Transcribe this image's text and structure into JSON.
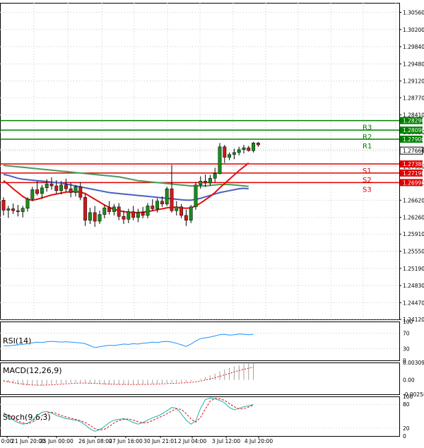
{
  "chart_data": {
    "type": "candlestick",
    "main": {
      "ylim": [
        1.2412,
        1.3076
      ],
      "yticks": [
        "1.30560",
        "1.30200",
        "1.29840",
        "1.29480",
        "1.29120",
        "1.28770",
        "1.28410",
        "1.28050",
        "1.27690",
        "1.27330",
        "1.26980",
        "1.26620",
        "1.26260",
        "1.25910",
        "1.25550",
        "1.25190",
        "1.24830",
        "1.24470",
        "1.24120"
      ],
      "xticks": [
        "0:00",
        "21 Jun 20:00",
        "25 Jun 00:00",
        "26 Jun 08:00",
        "27 Jun 16:00",
        "30 Jun 21:01",
        "2 Jul 04:00",
        "3 Jul 12:00",
        "4 Jul 20:00"
      ],
      "candles": [
        [
          1.2662,
          1.2668,
          1.263,
          1.2641
        ],
        [
          1.2641,
          1.265,
          1.2625,
          1.2644
        ],
        [
          1.2644,
          1.2655,
          1.2633,
          1.264
        ],
        [
          1.264,
          1.2652,
          1.2628,
          1.2638
        ],
        [
          1.2638,
          1.265,
          1.2626,
          1.2645
        ],
        [
          1.2645,
          1.2668,
          1.2638,
          1.2665
        ],
        [
          1.2665,
          1.269,
          1.266,
          1.2684
        ],
        [
          1.2684,
          1.2702,
          1.2672,
          1.2676
        ],
        [
          1.2676,
          1.2694,
          1.2665,
          1.2688
        ],
        [
          1.2688,
          1.2706,
          1.268,
          1.2696
        ],
        [
          1.2696,
          1.271,
          1.2684,
          1.2692
        ],
        [
          1.2692,
          1.2704,
          1.2676,
          1.2682
        ],
        [
          1.2682,
          1.2702,
          1.2674,
          1.2694
        ],
        [
          1.2694,
          1.2707,
          1.268,
          1.2686
        ],
        [
          1.2686,
          1.2699,
          1.2668,
          1.2678
        ],
        [
          1.2678,
          1.2694,
          1.267,
          1.269
        ],
        [
          1.269,
          1.27,
          1.2662,
          1.2668
        ],
        [
          1.2668,
          1.2676,
          1.2608,
          1.262
        ],
        [
          1.262,
          1.2646,
          1.2612,
          1.2636
        ],
        [
          1.2636,
          1.265,
          1.2606,
          1.2618
        ],
        [
          1.2618,
          1.264,
          1.2612,
          1.2632
        ],
        [
          1.2632,
          1.2652,
          1.2624,
          1.2646
        ],
        [
          1.2646,
          1.266,
          1.2632,
          1.2638
        ],
        [
          1.2638,
          1.2654,
          1.263,
          1.2648
        ],
        [
          1.2648,
          1.2656,
          1.262,
          1.2628
        ],
        [
          1.2628,
          1.264,
          1.2612,
          1.2622
        ],
        [
          1.2622,
          1.2644,
          1.2614,
          1.2638
        ],
        [
          1.2638,
          1.265,
          1.262,
          1.2626
        ],
        [
          1.2626,
          1.2644,
          1.2616,
          1.2636
        ],
        [
          1.2636,
          1.2648,
          1.2624,
          1.263
        ],
        [
          1.263,
          1.2656,
          1.2624,
          1.265
        ],
        [
          1.265,
          1.2664,
          1.264,
          1.2644
        ],
        [
          1.2644,
          1.2666,
          1.2636,
          1.266
        ],
        [
          1.266,
          1.267,
          1.2648,
          1.2654
        ],
        [
          1.2654,
          1.269,
          1.265,
          1.2686
        ],
        [
          1.2686,
          1.2736,
          1.2636,
          1.264
        ],
        [
          1.264,
          1.266,
          1.263,
          1.2648
        ],
        [
          1.2648,
          1.2654,
          1.2624,
          1.263
        ],
        [
          1.263,
          1.2642,
          1.2608,
          1.262
        ],
        [
          1.262,
          1.2652,
          1.2614,
          1.2648
        ],
        [
          1.2648,
          1.27,
          1.2642,
          1.2694
        ],
        [
          1.2694,
          1.2712,
          1.2686,
          1.2702
        ],
        [
          1.2702,
          1.2716,
          1.269,
          1.2698
        ],
        [
          1.2698,
          1.2715,
          1.2692,
          1.2708
        ],
        [
          1.2708,
          1.273,
          1.27,
          1.2718
        ],
        [
          1.2718,
          1.2782,
          1.2716,
          1.2774
        ],
        [
          1.2774,
          1.2778,
          1.274,
          1.2752
        ],
        [
          1.2752,
          1.2762,
          1.2746,
          1.2758
        ],
        [
          1.2758,
          1.277,
          1.2748,
          1.2762
        ],
        [
          1.2762,
          1.2774,
          1.2756,
          1.2768
        ],
        [
          1.2768,
          1.2778,
          1.276,
          1.2772
        ],
        [
          1.2772,
          1.2776,
          1.2764,
          1.2766
        ],
        [
          1.2766,
          1.2784,
          1.2762,
          1.2782
        ],
        [
          1.2782,
          1.2784,
          1.2774,
          1.2778
        ]
      ],
      "ma_slow": [
        1.2735,
        1.2734,
        1.2733,
        1.2732,
        1.2731,
        1.273,
        1.2729,
        1.2728,
        1.2727,
        1.2726,
        1.2725,
        1.2724,
        1.2723,
        1.2722,
        1.2721,
        1.272,
        1.2719,
        1.2718,
        1.2717,
        1.2716,
        1.2715,
        1.2714,
        1.2713,
        1.2712,
        1.2711,
        1.2709,
        1.2707,
        1.2705,
        1.2703,
        1.2702,
        1.2701,
        1.27,
        1.2699,
        1.2698,
        1.2697,
        1.2696,
        1.2695,
        1.2694,
        1.2693,
        1.2692,
        1.2692,
        1.2692,
        1.2692,
        1.2693,
        1.2694,
        1.2695,
        1.2695,
        1.2695,
        1.2694,
        1.2693,
        1.2692,
        1.2691
      ],
      "ma_mid": [
        1.2716,
        1.2714,
        1.2711,
        1.2708,
        1.2706,
        1.2705,
        1.2704,
        1.2703,
        1.2702,
        1.2701,
        1.27,
        1.2699,
        1.2698,
        1.2696,
        1.2694,
        1.2692,
        1.269,
        1.2688,
        1.2686,
        1.2684,
        1.2682,
        1.268,
        1.2678,
        1.2677,
        1.2676,
        1.2675,
        1.2674,
        1.2673,
        1.2672,
        1.2671,
        1.267,
        1.2669,
        1.2668,
        1.2667,
        1.2666,
        1.2665,
        1.2664,
        1.2663,
        1.2662,
        1.2662,
        1.2664,
        1.2666,
        1.2669,
        1.2672,
        1.2675,
        1.2678,
        1.268,
        1.2682,
        1.2684,
        1.2686,
        1.2687,
        1.2686
      ],
      "ma_fast": [
        1.2703,
        1.2695,
        1.2686,
        1.2678,
        1.267,
        1.2664,
        1.2662,
        1.2664,
        1.2667,
        1.267,
        1.2673,
        1.2675,
        1.2677,
        1.2679,
        1.268,
        1.268,
        1.2679,
        1.2676,
        1.267,
        1.2664,
        1.2658,
        1.2652,
        1.2647,
        1.2643,
        1.264,
        1.2638,
        1.2637,
        1.2636,
        1.2636,
        1.2637,
        1.2638,
        1.264,
        1.2642,
        1.2644,
        1.2646,
        1.2647,
        1.2647,
        1.2646,
        1.2645,
        1.2646,
        1.265,
        1.2656,
        1.2663,
        1.267,
        1.2678,
        1.2688,
        1.2697,
        1.2706,
        1.2715,
        1.2724,
        1.2732,
        1.274
      ],
      "levels": [
        {
          "name": "R3",
          "value": 1.2829,
          "label": "1.28290"
        },
        {
          "name": "R2",
          "value": 1.2809,
          "label": "1.28090"
        },
        {
          "name": "R1",
          "value": 1.279,
          "label": "1.27900"
        },
        {
          "name": "S1",
          "value": 1.2738,
          "label": "1.27380"
        },
        {
          "name": "S2",
          "value": 1.2719,
          "label": "1.27190"
        },
        {
          "name": "S3",
          "value": 1.2699,
          "label": "1.26990"
        }
      ],
      "current_price": "1.27660",
      "current_value": 1.2766
    },
    "rsi": {
      "label": "RSI(14)",
      "ylim": [
        0,
        100
      ],
      "yticks": [
        "100",
        "70",
        "30",
        "0"
      ],
      "values": [
        38,
        37,
        39,
        40,
        41,
        43,
        45,
        47,
        46,
        48,
        49,
        48,
        47,
        48,
        47,
        46,
        45,
        43,
        38,
        33,
        35,
        37,
        39,
        38,
        40,
        42,
        41,
        43,
        42,
        44,
        45,
        47,
        46,
        48,
        49,
        47,
        44,
        40,
        36,
        42,
        50,
        56,
        58,
        60,
        63,
        66,
        67,
        65,
        66,
        68,
        67,
        66,
        67
      ]
    },
    "macd": {
      "label": "MACD(12,26,9)",
      "yticks": [
        "0.003093",
        "0.00",
        "-0.002583"
      ],
      "ylim": [
        -0.002583,
        0.003093
      ],
      "histogram": [
        -0.0003,
        -0.0005,
        -0.00068,
        -0.00082,
        -0.00092,
        -0.00098,
        -0.001,
        -0.00098,
        -0.00094,
        -0.00088,
        -0.0008,
        -0.00072,
        -0.00064,
        -0.00058,
        -0.00052,
        -0.0005,
        -0.00052,
        -0.00058,
        -0.00066,
        -0.00074,
        -0.0008,
        -0.00084,
        -0.00086,
        -0.00088,
        -0.00088,
        -0.00087,
        -0.00086,
        -0.00084,
        -0.00082,
        -0.00079,
        -0.00075,
        -0.00071,
        -0.00067,
        -0.00062,
        -0.00056,
        -0.0005,
        -0.00046,
        -0.00044,
        -0.0004,
        -0.0003,
        -0.0001,
        0.0002,
        0.0005,
        0.0008,
        0.0011,
        0.0015,
        0.00185,
        0.00215,
        0.0024,
        0.00262,
        0.0028,
        0.00292,
        0.003
      ],
      "signal": [
        -0.0002,
        -0.00035,
        -0.0005,
        -0.00064,
        -0.00076,
        -0.00086,
        -0.00092,
        -0.00095,
        -0.00095,
        -0.00093,
        -0.00089,
        -0.00084,
        -0.00078,
        -0.00072,
        -0.00066,
        -0.00061,
        -0.00058,
        -0.00058,
        -0.0006,
        -0.00064,
        -0.00068,
        -0.00072,
        -0.00076,
        -0.00079,
        -0.00081,
        -0.00082,
        -0.00083,
        -0.00083,
        -0.00083,
        -0.00082,
        -0.0008,
        -0.00078,
        -0.00075,
        -0.00072,
        -0.00068,
        -0.00064,
        -0.0006,
        -0.00056,
        -0.00052,
        -0.00046,
        -0.00036,
        -0.00022,
        -4e-05,
        0.00016,
        0.00038,
        0.00062,
        0.00088,
        0.00114,
        0.0014,
        0.00165,
        0.00188,
        0.00208,
        0.00226
      ]
    },
    "stoch": {
      "label": "Stoch(9,6,3)",
      "ylim": [
        0,
        100
      ],
      "yticks": [
        "100",
        "80",
        "20",
        "0"
      ],
      "main": [
        55,
        48,
        40,
        34,
        30,
        32,
        40,
        52,
        60,
        62,
        58,
        52,
        48,
        44,
        42,
        40,
        36,
        28,
        18,
        12,
        16,
        24,
        34,
        40,
        42,
        44,
        40,
        34,
        30,
        34,
        40,
        46,
        50,
        56,
        64,
        72,
        70,
        56,
        40,
        30,
        38,
        70,
        92,
        96,
        94,
        90,
        84,
        72,
        66,
        70,
        74,
        76,
        80
      ],
      "signal": [
        58,
        52,
        45,
        38,
        33,
        31,
        35,
        42,
        51,
        58,
        60,
        57,
        52,
        48,
        45,
        42,
        39,
        34,
        27,
        19,
        15,
        17,
        24,
        33,
        39,
        42,
        43,
        40,
        36,
        33,
        34,
        39,
        45,
        50,
        56,
        63,
        69,
        67,
        57,
        43,
        35,
        47,
        68,
        88,
        95,
        94,
        90,
        82,
        74,
        68,
        69,
        73,
        78
      ]
    }
  }
}
